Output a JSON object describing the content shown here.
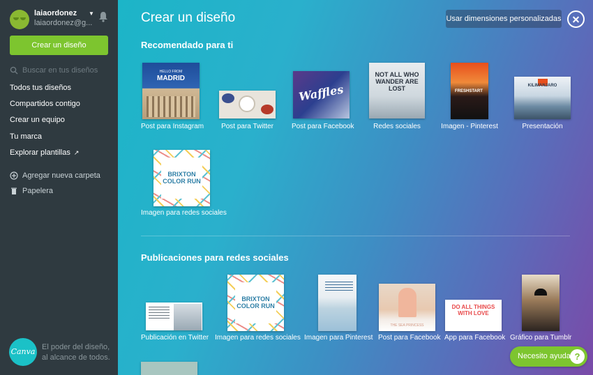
{
  "user": {
    "name": "laiaordonez",
    "email": "laiaordonez@g..."
  },
  "sidebar": {
    "create_label": "Crear un diseño",
    "search_placeholder": "Buscar en tus diseños",
    "items": [
      {
        "label": "Todos tus diseños"
      },
      {
        "label": "Compartidos contigo"
      },
      {
        "label": "Crear un equipo"
      },
      {
        "label": "Tu marca"
      },
      {
        "label": "Explorar plantillas"
      }
    ],
    "add_folder": "Agregar nueva carpeta",
    "trash": "Papelera",
    "tagline": "El poder del diseño, al alcance de todos.",
    "logo_text": "Canva"
  },
  "main": {
    "title": "Crear un diseño",
    "custom_dims_label": "Usar dimensiones personalizadas",
    "recommended": {
      "title": "Recomendado para ti",
      "tiles": [
        {
          "label": "Post para Instagram",
          "thumb_title_small": "HELLO FROM",
          "thumb_title": "MADRID"
        },
        {
          "label": "Post para Twitter",
          "thumb_title": ""
        },
        {
          "label": "Post para Facebook",
          "thumb_title": "Waffles"
        },
        {
          "label": "Redes sociales",
          "thumb_title": "NOT ALL WHO WANDER ARE LOST"
        },
        {
          "label": "Imagen - Pinterest",
          "thumb_title": "FRESHSTART"
        },
        {
          "label": "Presentación",
          "thumb_title": "KILIMANJARO"
        },
        {
          "label": "Imagen para redes sociales",
          "thumb_title": "BRIXTON COLOR RUN"
        }
      ]
    },
    "social": {
      "title": "Publicaciones para redes sociales",
      "tiles": [
        {
          "label": "Publicación en Twitter"
        },
        {
          "label": "Imagen para redes sociales",
          "thumb_title": "BRIXTON COLOR RUN"
        },
        {
          "label": "Imagen para Pinterest"
        },
        {
          "label": "Post para Facebook",
          "thumb_title": "THE SEA PRINCESS"
        },
        {
          "label": "App para Facebook",
          "thumb_title": "DO ALL THINGS WITH LOVE"
        },
        {
          "label": "Gráfico para Tumblr"
        }
      ]
    },
    "help_label": "Necesito ayuda",
    "help_icon_glyph": "?"
  },
  "colors": {
    "accent": "#7dc52f",
    "sidebar_bg": "#2f3a40",
    "teal": "#1cb5c8",
    "purple": "#7a4aa8"
  }
}
